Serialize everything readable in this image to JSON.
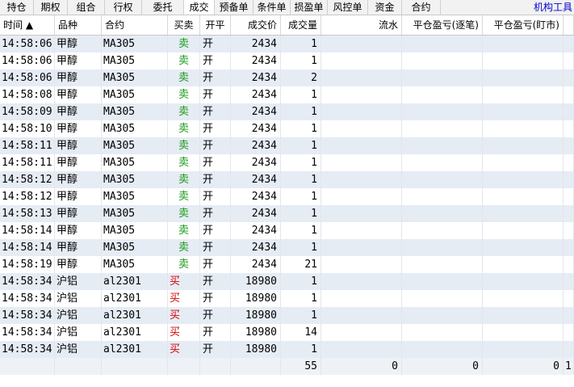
{
  "tabs": [
    "持仓",
    "期权",
    "组合",
    "行权",
    "委托",
    "成交",
    "预备单",
    "条件单",
    "损盈单",
    "风控单",
    "资金",
    "合约"
  ],
  "tab_right": "机构工具",
  "headers": {
    "time": "时间 ▲",
    "variety": "品种",
    "contract": "合约",
    "side": "买卖",
    "open_close": "开平",
    "price": "成交价",
    "volume": "成交量",
    "flow": "流水",
    "pnl_trade": "平仓盈亏(逐笔)",
    "pnl_mark": "平仓盈亏(盯市)"
  },
  "rows": [
    {
      "time": "14:58:06",
      "variety": "甲醇",
      "contract": "MA305",
      "side": "卖",
      "oc": "开",
      "price": "2434",
      "vol": "1"
    },
    {
      "time": "14:58:06",
      "variety": "甲醇",
      "contract": "MA305",
      "side": "卖",
      "oc": "开",
      "price": "2434",
      "vol": "1"
    },
    {
      "time": "14:58:06",
      "variety": "甲醇",
      "contract": "MA305",
      "side": "卖",
      "oc": "开",
      "price": "2434",
      "vol": "2"
    },
    {
      "time": "14:58:08",
      "variety": "甲醇",
      "contract": "MA305",
      "side": "卖",
      "oc": "开",
      "price": "2434",
      "vol": "1"
    },
    {
      "time": "14:58:09",
      "variety": "甲醇",
      "contract": "MA305",
      "side": "卖",
      "oc": "开",
      "price": "2434",
      "vol": "1"
    },
    {
      "time": "14:58:10",
      "variety": "甲醇",
      "contract": "MA305",
      "side": "卖",
      "oc": "开",
      "price": "2434",
      "vol": "1"
    },
    {
      "time": "14:58:11",
      "variety": "甲醇",
      "contract": "MA305",
      "side": "卖",
      "oc": "开",
      "price": "2434",
      "vol": "1"
    },
    {
      "time": "14:58:11",
      "variety": "甲醇",
      "contract": "MA305",
      "side": "卖",
      "oc": "开",
      "price": "2434",
      "vol": "1"
    },
    {
      "time": "14:58:12",
      "variety": "甲醇",
      "contract": "MA305",
      "side": "卖",
      "oc": "开",
      "price": "2434",
      "vol": "1"
    },
    {
      "time": "14:58:12",
      "variety": "甲醇",
      "contract": "MA305",
      "side": "卖",
      "oc": "开",
      "price": "2434",
      "vol": "1"
    },
    {
      "time": "14:58:13",
      "variety": "甲醇",
      "contract": "MA305",
      "side": "卖",
      "oc": "开",
      "price": "2434",
      "vol": "1"
    },
    {
      "time": "14:58:14",
      "variety": "甲醇",
      "contract": "MA305",
      "side": "卖",
      "oc": "开",
      "price": "2434",
      "vol": "1"
    },
    {
      "time": "14:58:14",
      "variety": "甲醇",
      "contract": "MA305",
      "side": "卖",
      "oc": "开",
      "price": "2434",
      "vol": "1"
    },
    {
      "time": "14:58:19",
      "variety": "甲醇",
      "contract": "MA305",
      "side": "卖",
      "oc": "开",
      "price": "2434",
      "vol": "21"
    },
    {
      "time": "14:58:34",
      "variety": "沪铝",
      "contract": "al2301",
      "side": "买",
      "oc": "开",
      "price": "18980",
      "vol": "1"
    },
    {
      "time": "14:58:34",
      "variety": "沪铝",
      "contract": "al2301",
      "side": "买",
      "oc": "开",
      "price": "18980",
      "vol": "1"
    },
    {
      "time": "14:58:34",
      "variety": "沪铝",
      "contract": "al2301",
      "side": "买",
      "oc": "开",
      "price": "18980",
      "vol": "1"
    },
    {
      "time": "14:58:34",
      "variety": "沪铝",
      "contract": "al2301",
      "side": "买",
      "oc": "开",
      "price": "18980",
      "vol": "14"
    },
    {
      "time": "14:58:34",
      "variety": "沪铝",
      "contract": "al2301",
      "side": "买",
      "oc": "开",
      "price": "18980",
      "vol": "1"
    }
  ],
  "totals": {
    "volume": "55",
    "flow": "0",
    "pnl_trade": "0",
    "pnl_mark": "0",
    "last": "1"
  },
  "colors": {
    "sell": "#1a9a1a",
    "buy": "#d40000",
    "alt_row": "#e6ecf4",
    "link": "#0000cc"
  }
}
